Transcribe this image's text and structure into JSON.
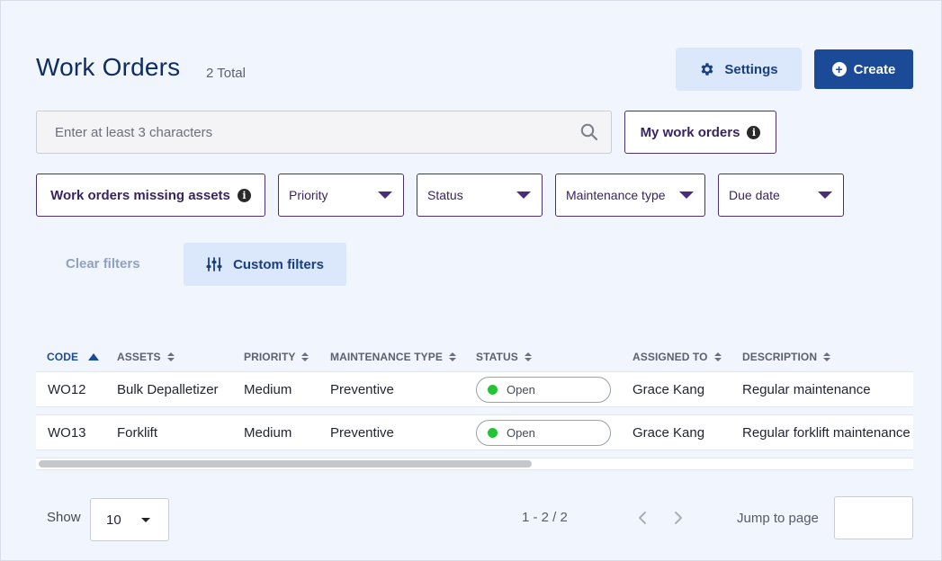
{
  "header": {
    "title": "Work Orders",
    "total": "2 Total",
    "settings_label": "Settings",
    "create_label": "Create"
  },
  "search": {
    "placeholder": "Enter at least 3 characters",
    "value": ""
  },
  "my_work_orders_label": "My work orders",
  "filters": {
    "missing_assets_label": "Work orders missing assets",
    "dropdowns": [
      {
        "label": "Priority"
      },
      {
        "label": "Status"
      },
      {
        "label": "Maintenance type"
      },
      {
        "label": "Due date"
      }
    ],
    "clear_label": "Clear filters",
    "custom_label": "Custom filters"
  },
  "table": {
    "columns": [
      {
        "label": "CODE"
      },
      {
        "label": "ASSETS"
      },
      {
        "label": "PRIORITY"
      },
      {
        "label": "MAINTENANCE TYPE"
      },
      {
        "label": "STATUS"
      },
      {
        "label": "ASSIGNED TO"
      },
      {
        "label": "DESCRIPTION"
      }
    ],
    "rows": [
      {
        "code": "WO12",
        "asset": "Bulk Depalletizer",
        "priority": "Medium",
        "maintenance_type": "Preventive",
        "status": "Open",
        "assigned_to": "Grace Kang",
        "description": "Regular maintenance"
      },
      {
        "code": "WO13",
        "asset": "Forklift",
        "priority": "Medium",
        "maintenance_type": "Preventive",
        "status": "Open",
        "assigned_to": "Grace Kang",
        "description": "Regular forklift maintenance"
      }
    ]
  },
  "pagination": {
    "show_label": "Show",
    "page_size": "10",
    "range": "1 - 2 / 2",
    "jump_label": "Jump to page",
    "jump_value": ""
  },
  "colors": {
    "primary": "#1b4a96",
    "status_open": "#22c334",
    "outline_purple": "#4a3070"
  }
}
